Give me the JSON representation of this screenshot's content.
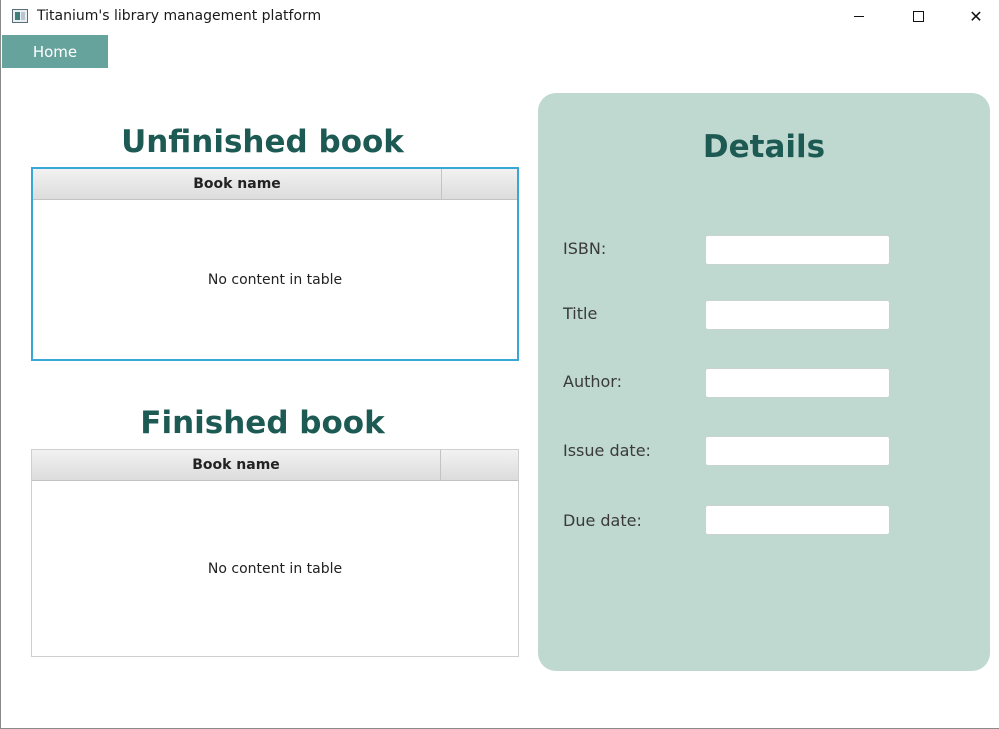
{
  "window": {
    "title": "Titanium's library management platform",
    "app_icon": "app-icon",
    "controls": {
      "minimize": "—",
      "maximize": "☐",
      "close": "✕"
    }
  },
  "menu": {
    "home_label": "Home"
  },
  "unfinished": {
    "title": "Unfinished book",
    "table": {
      "columns": [
        "Book name",
        ""
      ],
      "empty_message": "No content in table"
    }
  },
  "finished": {
    "title": "Finished book",
    "table": {
      "columns": [
        "Book name",
        ""
      ],
      "empty_message": "No content in table"
    }
  },
  "details": {
    "title": "Details",
    "fields": [
      {
        "label": "ISBN:",
        "value": ""
      },
      {
        "label": "Title",
        "value": ""
      },
      {
        "label": "Author:",
        "value": ""
      },
      {
        "label": "Issue date:",
        "value": ""
      },
      {
        "label": "Due date:",
        "value": ""
      }
    ]
  },
  "colors": {
    "accent": "#67a39d",
    "heading": "#1c5a53",
    "panel": "#bfd9d0",
    "focus_border": "#39a7d6"
  }
}
